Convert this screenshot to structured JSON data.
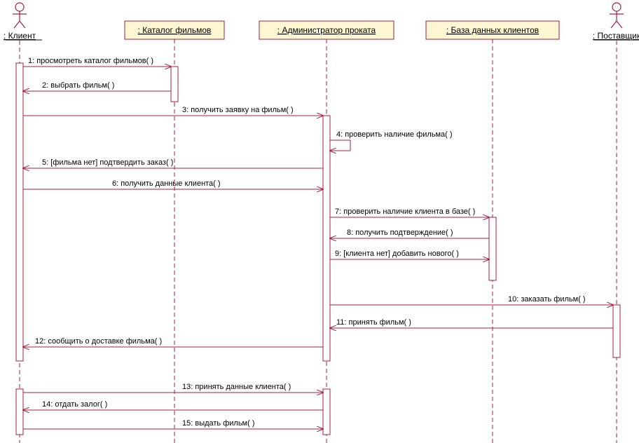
{
  "participants": {
    "client": ": Клиент",
    "catalog": ": Каталог фильмов",
    "admin": ": Администратор проката",
    "db": ": База данных клиентов",
    "supplier": ": Поставщик"
  },
  "messages": {
    "m1": "1: просмотреть каталог фильмов( )",
    "m2": "2: выбрать фильм( )",
    "m3": "3: получить заявку на фильм( )",
    "m4": "4: проверить наличие фильма( )",
    "m5": "5: [фильма нет] подтвердить заказ( )",
    "m6": "6: получить данные клиента( )",
    "m7": "7: проверить наличие клиента в базе( )",
    "m8": "8: получить подтверждение( )",
    "m9": "9: [клиента нет] добавить нового( )",
    "m10": "10: заказать фильм( )",
    "m11": "11: принять фильм( )",
    "m12": "12: сообщить о доставке фильма( )",
    "m13": "13: принять данные клиента( )",
    "m14": "14: отдать залог( )",
    "m15": "15: выдать фильм( )"
  }
}
